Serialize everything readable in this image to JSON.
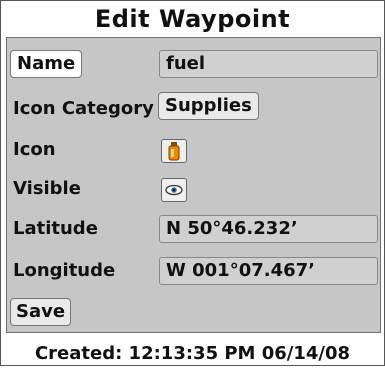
{
  "title": "Edit Waypoint",
  "fields": {
    "name": {
      "label": "Name",
      "value": "fuel"
    },
    "icon_category": {
      "label": "Icon Category",
      "value": "Supplies"
    },
    "icon": {
      "label": "Icon",
      "icon_name": "fuel-bottle-icon"
    },
    "visible": {
      "label": "Visible",
      "icon_name": "eye-icon"
    },
    "latitude": {
      "label": "Latitude",
      "value": "N  50°46.232’"
    },
    "longitude": {
      "label": "Longitude",
      "value": "W  001°07.467’"
    }
  },
  "save_label": "Save",
  "footer": "Created:  12:13:35  PM  06/14/08",
  "colors": {
    "panel": "#c6c6c6",
    "field": "#d0d0d0",
    "icon_orange": "#e88a00"
  }
}
